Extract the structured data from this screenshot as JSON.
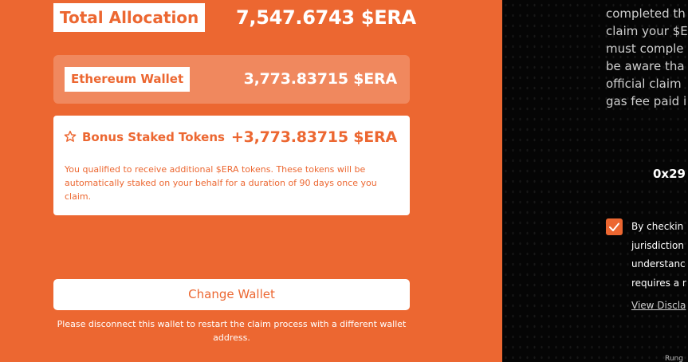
{
  "allocation": {
    "total_label": "Total Allocation",
    "total_value": "7,547.6743 $ERA"
  },
  "ethereum_wallet": {
    "label": "Ethereum Wallet",
    "value": "3,773.83715 $ERA"
  },
  "bonus": {
    "icon": "star-outline-icon",
    "label": "Bonus Staked Tokens",
    "value": "+3,773.83715 $ERA",
    "note": "You qualified to receive additional $ERA tokens. These tokens will be automatically staked on your behalf for a duration of 90 days once you claim."
  },
  "change_wallet": {
    "button_label": "Change Wallet",
    "note": "Please disconnect this wallet to restart the claim process with a different wallet address."
  },
  "right_panel": {
    "lines": [
      "completed th",
      "claim your $E",
      "must comple",
      "be aware tha",
      "official claim",
      "gas fee paid i"
    ],
    "address": "0x29",
    "consent_lines": [
      "By checkin",
      "jurisdiction",
      "understanc",
      "requires a r"
    ],
    "disclaimer_link": "View Discla",
    "footer_fragment": "Rung"
  },
  "colors": {
    "accent": "#ec6731",
    "dark_bg": "#050505",
    "white": "#ffffff"
  }
}
